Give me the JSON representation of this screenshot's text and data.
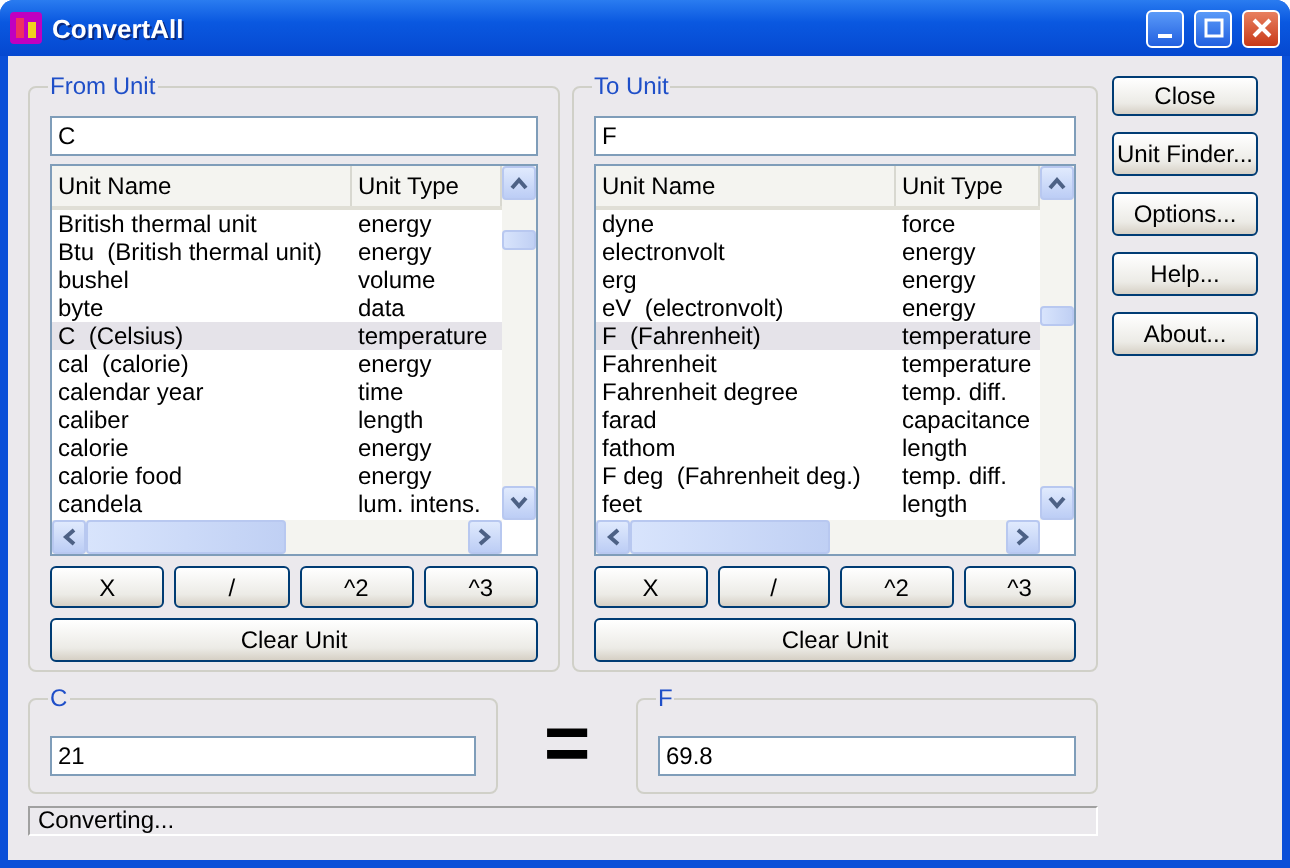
{
  "window": {
    "title": "ConvertAll"
  },
  "panels": [
    {
      "title": "From Unit",
      "search": "C",
      "columns": [
        "Unit Name",
        "Unit Type"
      ],
      "rows": [
        {
          "name": "British thermal unit",
          "type": "energy",
          "selected": false
        },
        {
          "name": "Btu  (British thermal unit)",
          "type": "energy",
          "selected": false
        },
        {
          "name": "bushel",
          "type": "volume",
          "selected": false
        },
        {
          "name": "byte",
          "type": "data",
          "selected": false
        },
        {
          "name": "C  (Celsius)",
          "type": "temperature",
          "selected": true
        },
        {
          "name": "cal  (calorie)",
          "type": "energy",
          "selected": false
        },
        {
          "name": "calendar year",
          "type": "time",
          "selected": false
        },
        {
          "name": "caliber",
          "type": "length",
          "selected": false
        },
        {
          "name": "calorie",
          "type": "energy",
          "selected": false
        },
        {
          "name": "calorie food",
          "type": "energy",
          "selected": false
        },
        {
          "name": "candela",
          "type": "lum. intens.",
          "selected": false
        }
      ],
      "buttons": [
        "X",
        "/",
        "^2",
        "^3"
      ],
      "clear_button": "Clear Unit"
    },
    {
      "title": "To Unit",
      "search": "F",
      "columns": [
        "Unit Name",
        "Unit Type"
      ],
      "rows": [
        {
          "name": "dyne",
          "type": "force",
          "selected": false
        },
        {
          "name": "electronvolt",
          "type": "energy",
          "selected": false
        },
        {
          "name": "erg",
          "type": "energy",
          "selected": false
        },
        {
          "name": "eV  (electronvolt)",
          "type": "energy",
          "selected": false
        },
        {
          "name": "F  (Fahrenheit)",
          "type": "temperature",
          "selected": true
        },
        {
          "name": "Fahrenheit",
          "type": "temperature",
          "selected": false
        },
        {
          "name": "Fahrenheit degree",
          "type": "temp. diff.",
          "selected": false
        },
        {
          "name": "farad",
          "type": "capacitance",
          "selected": false
        },
        {
          "name": "fathom",
          "type": "length",
          "selected": false
        },
        {
          "name": "F deg  (Fahrenheit deg.)",
          "type": "temp. diff.",
          "selected": false
        },
        {
          "name": "feet",
          "type": "length",
          "selected": false
        }
      ],
      "buttons": [
        "X",
        "/",
        "^2",
        "^3"
      ],
      "clear_button": "Clear Unit"
    }
  ],
  "values": [
    {
      "label": "C",
      "value": "21"
    },
    {
      "label": "F",
      "value": "69.8"
    }
  ],
  "equals": "=",
  "side_buttons": [
    "Close",
    "Unit Finder...",
    "Options...",
    "Help...",
    "About..."
  ],
  "status_bar": "Converting..."
}
